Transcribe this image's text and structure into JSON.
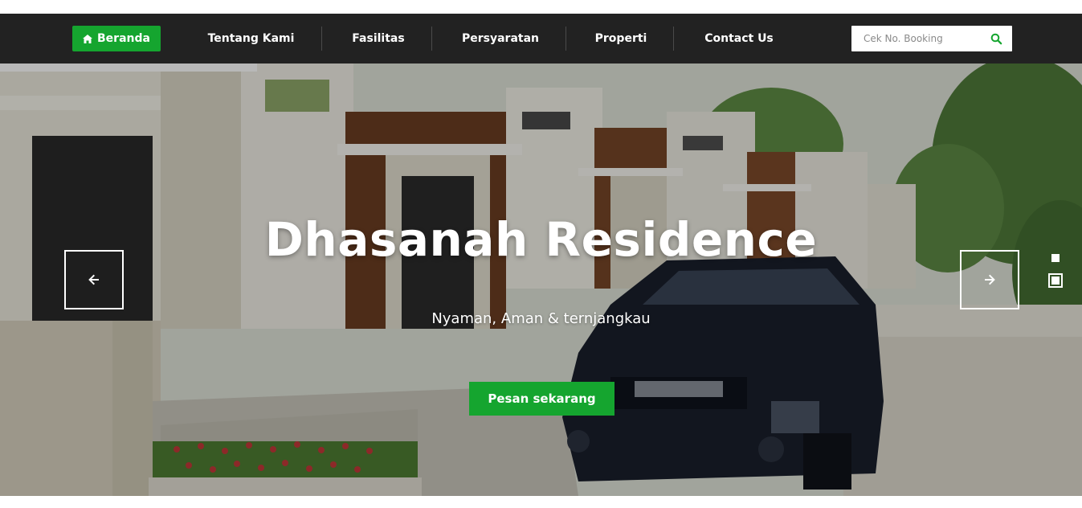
{
  "nav": {
    "home_label": "Beranda",
    "items": [
      {
        "label": "Tentang Kami"
      },
      {
        "label": "Fasilitas"
      },
      {
        "label": "Persyaratan"
      },
      {
        "label": "Properti"
      },
      {
        "label": "Contact Us"
      }
    ],
    "search_placeholder": "Cek No. Booking",
    "search_icon": "search-icon",
    "home_icon": "home-icon"
  },
  "hero": {
    "title": "Dhasanah Residence",
    "subtitle": "Nyaman, Aman & ternjangkau",
    "cta_label": "Pesan sekarang",
    "prev_icon": "arrow-left-icon",
    "next_icon": "arrow-right-icon",
    "slide_count": 2,
    "active_slide": 2
  },
  "colors": {
    "accent": "#15a52f",
    "navbar": "#222222",
    "text_light": "#ffffff"
  }
}
